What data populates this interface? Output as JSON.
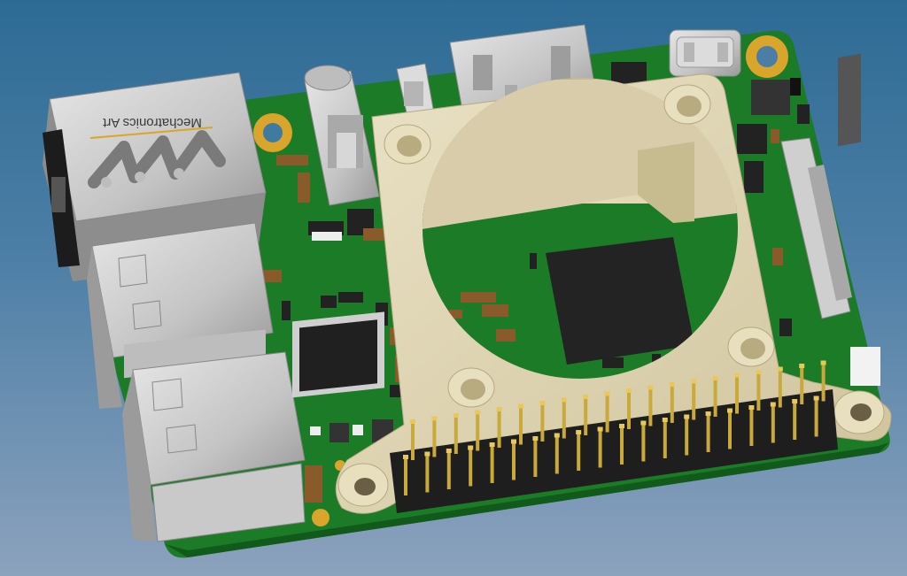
{
  "viewport": {
    "background_top": "#2d6b94",
    "background_bottom": "#8ca2bd"
  },
  "model": {
    "board_color": "#1f8a2c",
    "fan_mount_color": "#d9ceaa",
    "metal_color": "#c9c9c9",
    "chip_color": "#222222",
    "pad_color": "#d9a52a",
    "logo_text": "Mechatronics Art",
    "header_pin_count": 40
  }
}
